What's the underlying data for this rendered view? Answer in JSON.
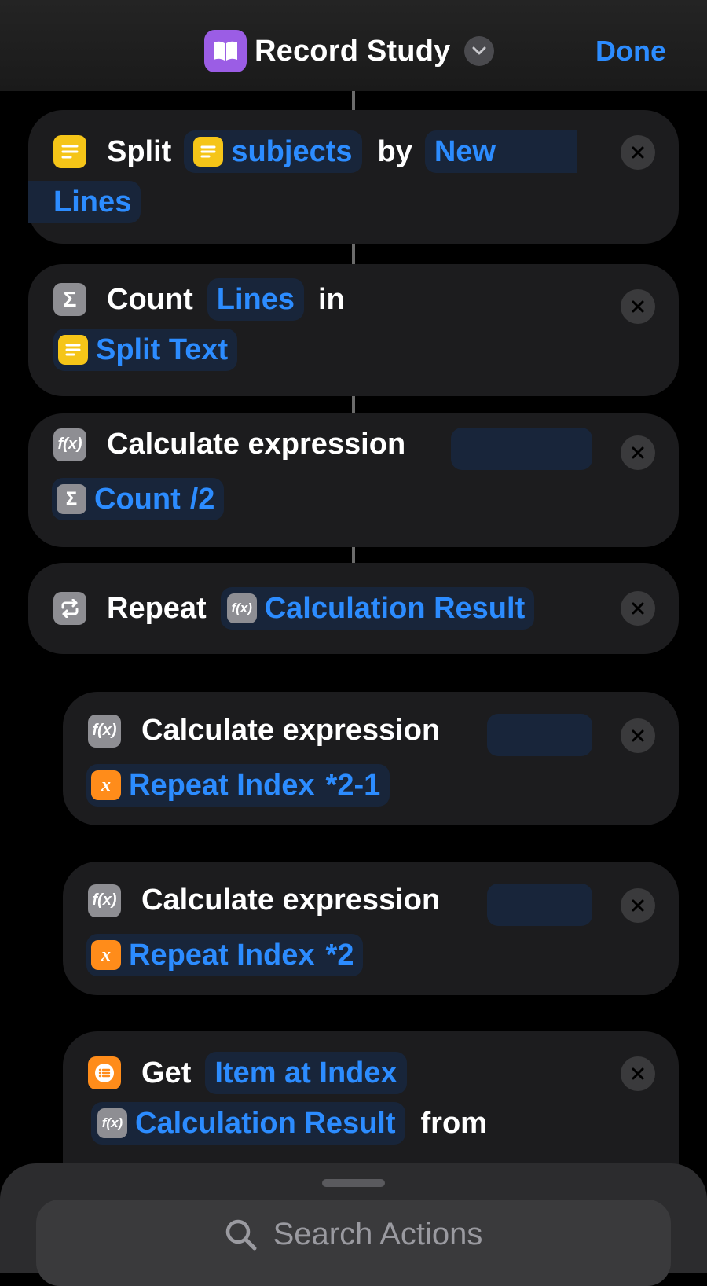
{
  "header": {
    "title": "Record Study",
    "done_label": "Done",
    "app_icon": "book-icon",
    "app_icon_color": "#9b5de5"
  },
  "actions": [
    {
      "verb": "Split",
      "input": "subjects",
      "by_label": "by",
      "separator_line1": "New",
      "separator_line2": "Lines"
    },
    {
      "verb": "Count",
      "param": "Lines",
      "in_label": "in",
      "source": "Split Text"
    },
    {
      "verb": "Calculate expression",
      "var": "Count",
      "expr_suffix": "/2"
    },
    {
      "verb": "Repeat",
      "var": "Calculation Result"
    },
    {
      "verb": "Calculate expression",
      "var": "Repeat Index",
      "expr_suffix": "*2-1"
    },
    {
      "verb": "Calculate expression",
      "var": "Repeat Index",
      "expr_suffix": "*2"
    },
    {
      "verb": "Get",
      "param": "Item at Index",
      "var": "Calculation Result",
      "from_label": "from"
    }
  ],
  "search": {
    "placeholder": "Search Actions"
  },
  "colors": {
    "accent": "#2c8cff",
    "text_icon": "#f5c518",
    "math_icon": "#8e8e93",
    "variable_icon": "#ff8c1a"
  }
}
